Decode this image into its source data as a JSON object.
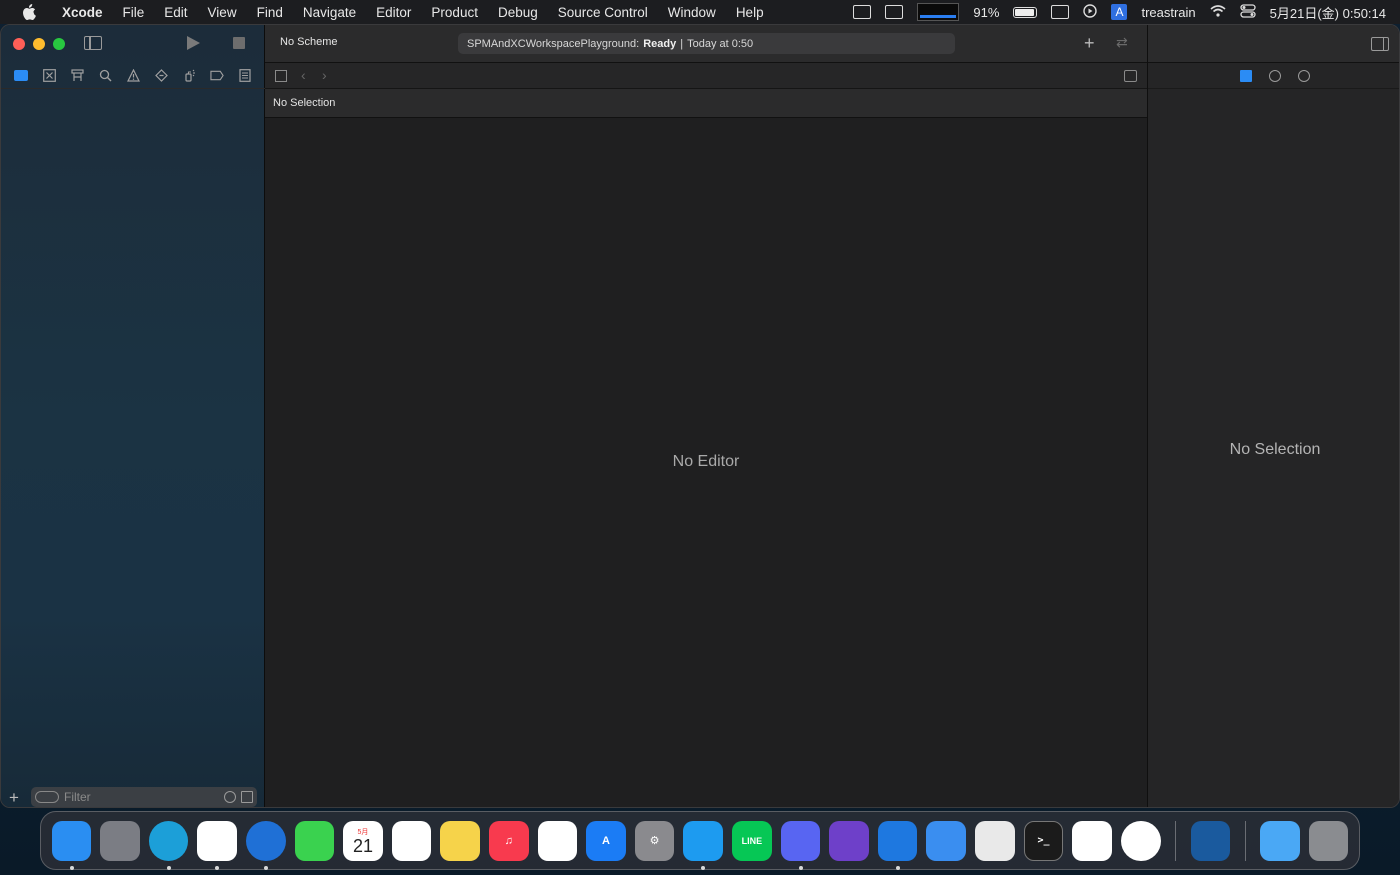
{
  "menubar": {
    "app": "Xcode",
    "items": [
      "File",
      "Edit",
      "View",
      "Find",
      "Navigate",
      "Editor",
      "Product",
      "Debug",
      "Source Control",
      "Window",
      "Help"
    ],
    "status": {
      "battery": "91%",
      "input_source": "A",
      "user": "treastrain",
      "clock": "5月21日(金)  0:50:14"
    }
  },
  "toolbar": {
    "scheme": "No Scheme",
    "activity_project": "SPMAndXCWorkspacePlayground:",
    "activity_status": "Ready",
    "activity_separator": "|",
    "activity_time": "Today at 0:50"
  },
  "editor": {
    "path": "No Selection",
    "placeholder": "No Editor"
  },
  "inspector": {
    "placeholder": "No Selection"
  },
  "navigator": {
    "filter_placeholder": "Filter"
  },
  "dock": {
    "apps": [
      {
        "name": "Finder",
        "icon": "finder-icon",
        "color": "#2a8ef2",
        "running": true
      },
      {
        "name": "Launchpad",
        "icon": "launchpad-icon",
        "color": "#7b7d84",
        "running": false
      },
      {
        "name": "Microsoft Edge",
        "icon": "edge-icon",
        "color": "#1c9fd8",
        "running": true
      },
      {
        "name": "Slack",
        "icon": "slack-icon",
        "color": "#ffffff",
        "running": true
      },
      {
        "name": "Navigation",
        "icon": "compass-icon",
        "color": "#1f70d6",
        "running": true
      },
      {
        "name": "Messages",
        "icon": "messages-icon",
        "color": "#3ad24f",
        "running": false
      },
      {
        "name": "Calendar",
        "icon": "calendar-icon",
        "color": "#ffffff",
        "running": false,
        "month": "5月",
        "day": "21"
      },
      {
        "name": "Reminders",
        "icon": "reminders-icon",
        "color": "#ffffff",
        "running": false
      },
      {
        "name": "Notes",
        "icon": "notes-icon",
        "color": "#f6d34a",
        "running": false
      },
      {
        "name": "Music",
        "icon": "music-icon",
        "color": "#f83a4e",
        "running": false
      },
      {
        "name": "Keynote",
        "icon": "keynote-icon",
        "color": "#ffffff",
        "running": false
      },
      {
        "name": "App Store",
        "icon": "appstore-icon",
        "color": "#1b7cf5",
        "running": false
      },
      {
        "name": "System Preferences",
        "icon": "settings-icon",
        "color": "#8a8a8e",
        "running": false
      },
      {
        "name": "Twitter",
        "icon": "twitter-icon",
        "color": "#1d9bf0",
        "running": true
      },
      {
        "name": "LINE",
        "icon": "line-icon",
        "color": "#06c755",
        "running": false
      },
      {
        "name": "Discord",
        "icon": "discord-icon",
        "color": "#5865f2",
        "running": true
      },
      {
        "name": "GitHub Desktop",
        "icon": "github-icon",
        "color": "#6e40c9",
        "running": false
      },
      {
        "name": "Xcode",
        "icon": "xcode-icon",
        "color": "#1e78e0",
        "running": true
      },
      {
        "name": "Xcode Beta",
        "icon": "xcode-beta-icon",
        "color": "#3a8ef0",
        "running": false
      },
      {
        "name": "TextEdit",
        "icon": "textedit-icon",
        "color": "#e9e9e9",
        "running": false
      },
      {
        "name": "Terminal",
        "icon": "terminal-icon",
        "color": "#1b1b1b",
        "running": false
      },
      {
        "name": "Visual Studio Code",
        "icon": "vscode-icon",
        "color": "#ffffff",
        "running": false
      },
      {
        "name": "Transporter",
        "icon": "transporter-icon",
        "color": "#ffffff",
        "running": false
      },
      {
        "name": "Affinity Designer",
        "icon": "affinity-icon",
        "color": "#1a5a9e",
        "running": false
      },
      {
        "name": "Downloads",
        "icon": "folder-icon",
        "color": "#4aa8f5",
        "running": false
      },
      {
        "name": "Trash",
        "icon": "trash-icon",
        "color": "#8a8c90",
        "running": false
      }
    ]
  }
}
